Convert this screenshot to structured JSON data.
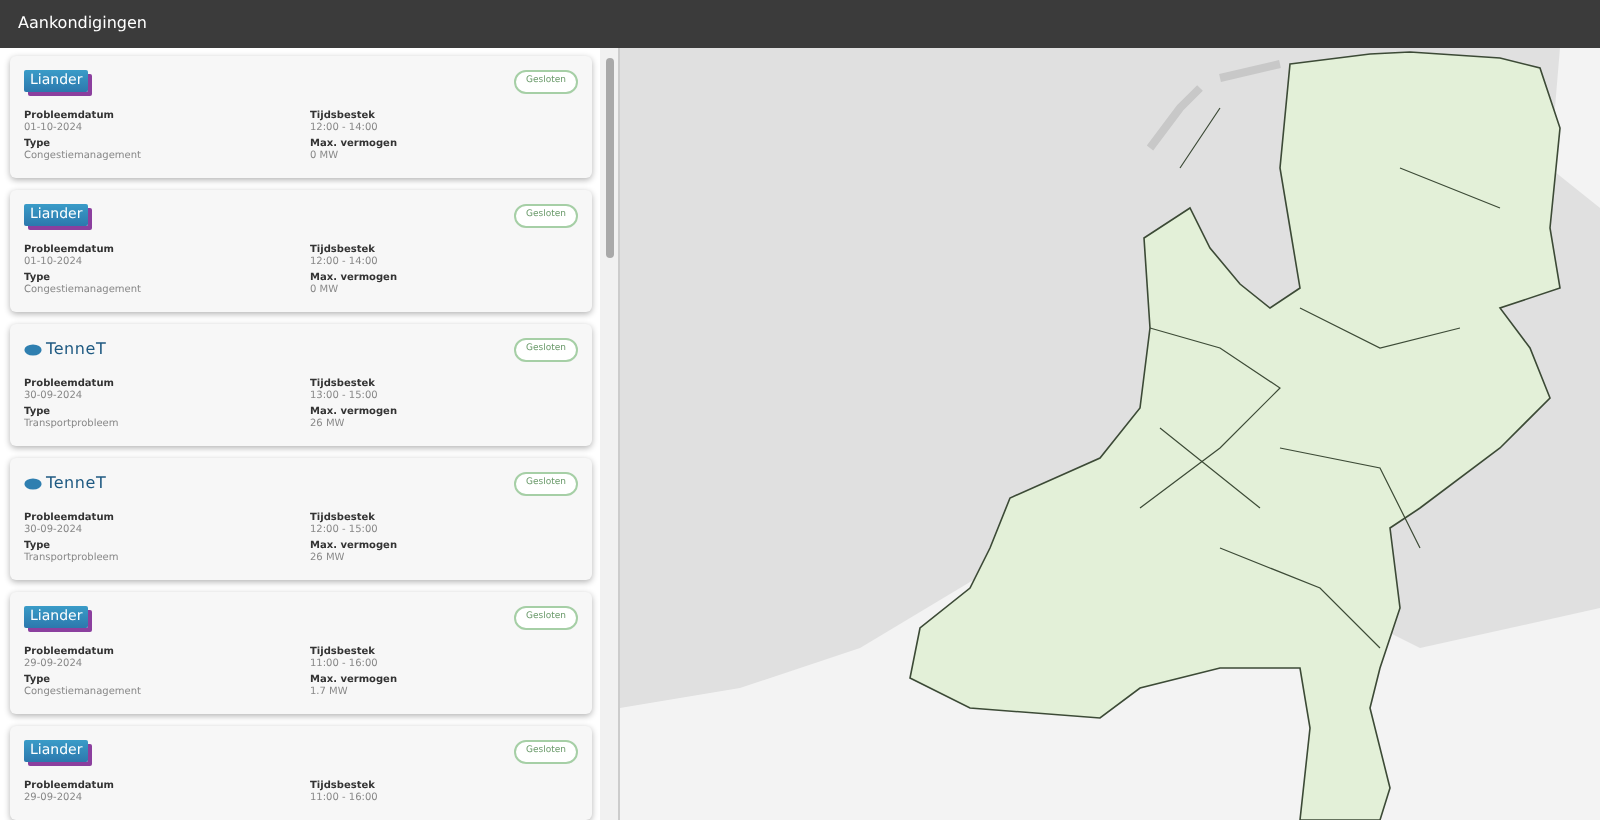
{
  "header": {
    "title": "Aankondigingen"
  },
  "announcements": [
    {
      "kind": "liander",
      "logo_text": "Liander",
      "status": "Gesloten",
      "fields": [
        {
          "label": "Probleemdatum",
          "value": "01-10-2024"
        },
        {
          "label": "Tijdsbestek",
          "value": "12:00 - 14:00"
        },
        {
          "label": "Type",
          "value": "Congestiemanagement"
        },
        {
          "label": "Max. vermogen",
          "value": "0 MW"
        }
      ]
    },
    {
      "kind": "liander",
      "logo_text": "Liander",
      "status": "Gesloten",
      "fields": [
        {
          "label": "Probleemdatum",
          "value": "01-10-2024"
        },
        {
          "label": "Tijdsbestek",
          "value": "12:00 - 14:00"
        },
        {
          "label": "Type",
          "value": "Congestiemanagement"
        },
        {
          "label": "Max. vermogen",
          "value": "0 MW"
        }
      ]
    },
    {
      "kind": "tennet",
      "logo_text": "TenneT",
      "status": "Gesloten",
      "fields": [
        {
          "label": "Probleemdatum",
          "value": "30-09-2024"
        },
        {
          "label": "Tijdsbestek",
          "value": "13:00 - 15:00"
        },
        {
          "label": "Type",
          "value": "Transportprobleem"
        },
        {
          "label": "Max. vermogen",
          "value": "26 MW"
        }
      ]
    },
    {
      "kind": "tennet",
      "logo_text": "TenneT",
      "status": "Gesloten",
      "fields": [
        {
          "label": "Probleemdatum",
          "value": "30-09-2024"
        },
        {
          "label": "Tijdsbestek",
          "value": "12:00 - 15:00"
        },
        {
          "label": "Type",
          "value": "Transportprobleem"
        },
        {
          "label": "Max. vermogen",
          "value": "26 MW"
        }
      ]
    },
    {
      "kind": "liander",
      "logo_text": "Liander",
      "status": "Gesloten",
      "fields": [
        {
          "label": "Probleemdatum",
          "value": "29-09-2024"
        },
        {
          "label": "Tijdsbestek",
          "value": "11:00 - 16:00"
        },
        {
          "label": "Type",
          "value": "Congestiemanagement"
        },
        {
          "label": "Max. vermogen",
          "value": "1.7 MW"
        }
      ]
    },
    {
      "kind": "liander",
      "logo_text": "Liander",
      "status": "Gesloten",
      "fields": [
        {
          "label": "Probleemdatum",
          "value": "29-09-2024"
        },
        {
          "label": "Tijdsbestek",
          "value": "11:00 - 16:00"
        }
      ]
    }
  ]
}
